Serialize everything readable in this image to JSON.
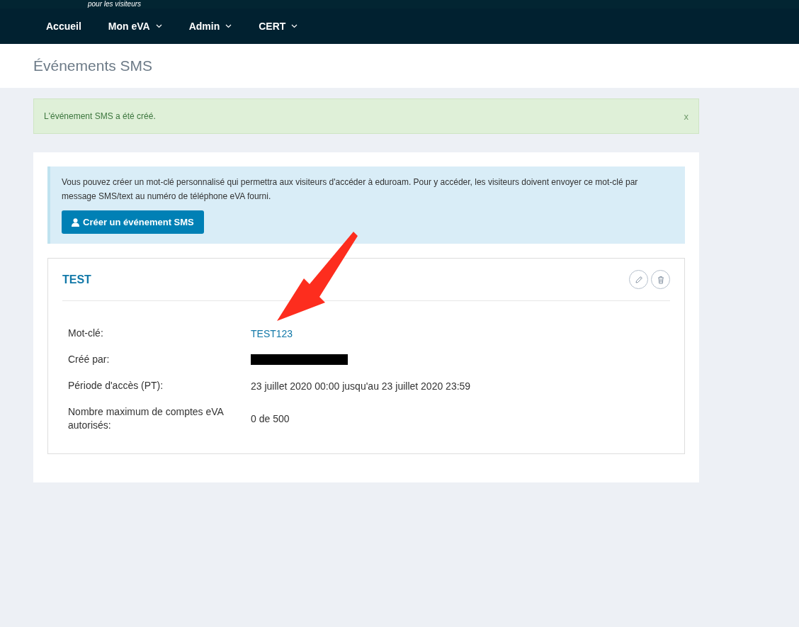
{
  "header": {
    "tagline": "pour les visiteurs"
  },
  "nav": [
    {
      "label": "Accueil",
      "dropdown": false
    },
    {
      "label": "Mon eVA",
      "dropdown": true
    },
    {
      "label": "Admin",
      "dropdown": true
    },
    {
      "label": "CERT",
      "dropdown": true
    }
  ],
  "page_title": "Événements SMS",
  "alert": {
    "message": "L'événement SMS a été créé.",
    "close": "x"
  },
  "info": {
    "text": "Vous pouvez créer un mot-clé personnalisé qui permettra aux visiteurs d'accéder à eduroam. Pour y accéder, les visiteurs doivent envoyer ce mot-clé par message SMS/text au numéro de téléphone eVA fourni.",
    "button": "Créer un événement SMS"
  },
  "event": {
    "title": "TEST",
    "details": [
      {
        "label": "Mot-clé:",
        "kind": "link",
        "value": "TEST123"
      },
      {
        "label": "Créé par:",
        "kind": "redacted"
      },
      {
        "label": "Période d'accès (PT):",
        "kind": "text",
        "value": "23 juillet 2020 00:00 jusqu'au 23 juillet 2020 23:59"
      },
      {
        "label": "Nombre maximum de comptes eVA autorisés:",
        "kind": "text",
        "value": "0 de 500"
      }
    ]
  }
}
